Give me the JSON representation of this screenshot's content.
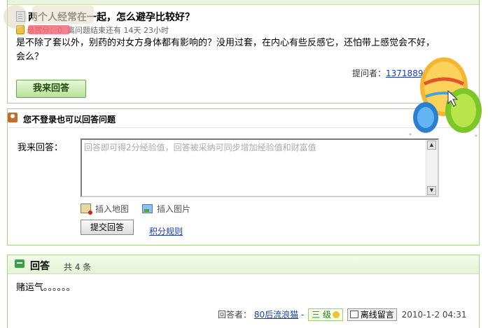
{
  "question": {
    "title": "两个人经常在一起，怎么避孕比较好？",
    "bounty_label": "悬赏分：",
    "bounty_value": "0",
    "remaining_text": "离问题结束还有 14天 23小时",
    "body": "是不除了套以外，别药的对女方身体都有影响的？没用过套，在内心有些反感它，还怕带上感觉会不好，会么？",
    "asker_label": "提问者：",
    "asker_name": "13718897",
    "answer_button": "我来回答"
  },
  "answer_form": {
    "section_title": "您不登录也可以回答问题",
    "label": "我来回答：",
    "placeholder": "回答即可得2分经验值，回答被采纳可同步增加经验值和财富值",
    "insert_map": "插入地图",
    "insert_image": "插入图片",
    "submit": "提交回答",
    "rules": "积分规则"
  },
  "answers": {
    "title": "回答",
    "count": "共 4 条",
    "items": [
      {
        "text": "赌运气。。。。。。",
        "answerer_label": "回答者：",
        "answerer": "80后流浪猫",
        "sep": "-",
        "level": "三 级",
        "offline_msg": "离线留言",
        "time": "2010-1-2 04:31"
      }
    ]
  }
}
